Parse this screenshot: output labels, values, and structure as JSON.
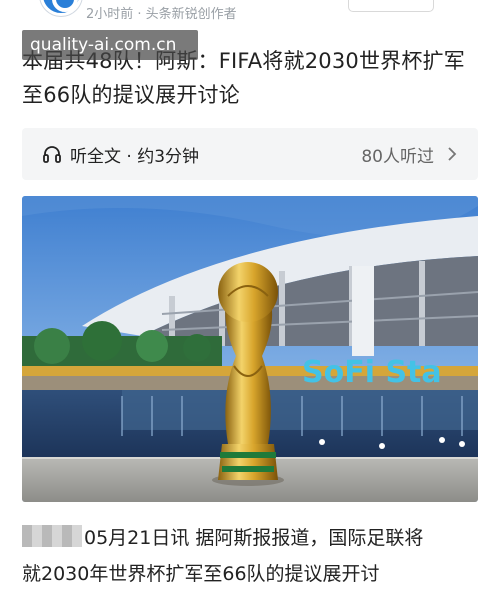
{
  "meta": {
    "time_source": "2小时前 · 头条新锐创作者"
  },
  "watermark": "quality-ai.com.cn",
  "headline": "本届共48队！阿斯：FIFA将就2030世界杯扩军至66队的提议展开讨论",
  "listen_bar": {
    "label": "听全文 · 约3分钟",
    "listeners": "80人听过"
  },
  "hero_image": {
    "stadium_sign": "SoFi Sta"
  },
  "body": {
    "line1": "05月21日讯 据阿斯报报道，国际足联将",
    "line2": "就2030年世界杯扩军至66队的提议展开讨"
  },
  "colors": {
    "accent": "#2a7fd8",
    "sign": "#43c2e6"
  }
}
